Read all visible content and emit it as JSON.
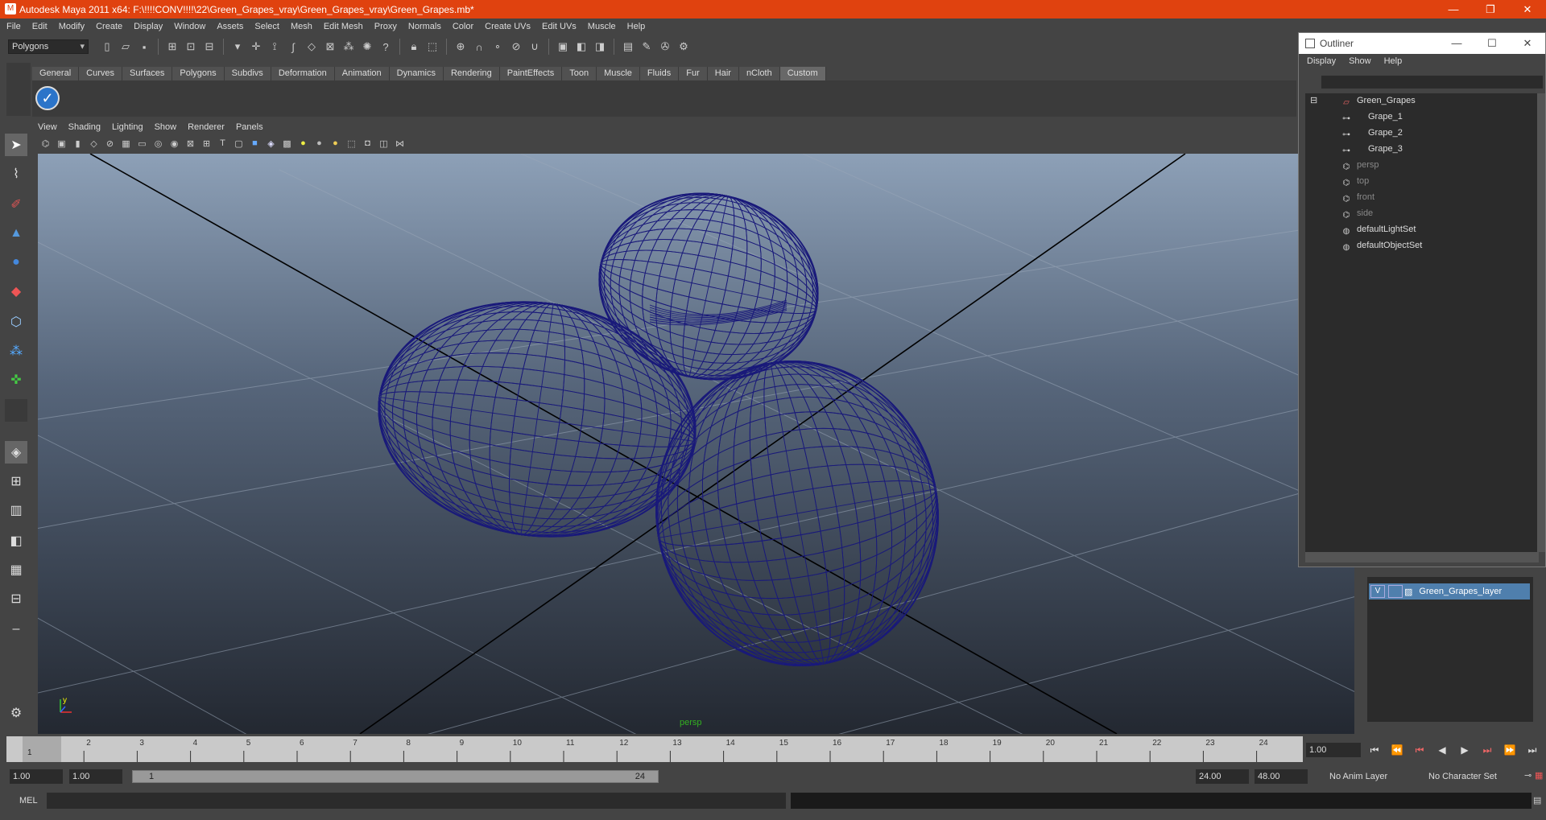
{
  "window": {
    "title": "Autodesk Maya 2011 x64: F:\\!!!!CONV!!!!\\22\\Green_Grapes_vray\\Green_Grapes_vray\\Green_Grapes.mb*"
  },
  "menubar": [
    "File",
    "Edit",
    "Modify",
    "Create",
    "Display",
    "Window",
    "Assets",
    "Select",
    "Mesh",
    "Edit Mesh",
    "Proxy",
    "Normals",
    "Color",
    "Create UVs",
    "Edit UVs",
    "Muscle",
    "Help"
  ],
  "statusline": {
    "mode": "Polygons"
  },
  "shelf": {
    "tabs": [
      "General",
      "Curves",
      "Surfaces",
      "Polygons",
      "Subdivs",
      "Deformation",
      "Animation",
      "Dynamics",
      "Rendering",
      "PaintEffects",
      "Toon",
      "Muscle",
      "Fluids",
      "Fur",
      "Hair",
      "nCloth",
      "Custom"
    ],
    "active": "Custom"
  },
  "viewport": {
    "menu": [
      "View",
      "Shading",
      "Lighting",
      "Show",
      "Renderer",
      "Panels"
    ],
    "camera": "persp",
    "wire_color": "#1a1a7a"
  },
  "outliner": {
    "title": "Outliner",
    "menu": [
      "Display",
      "Show",
      "Help"
    ],
    "items": [
      {
        "label": "Green_Grapes",
        "depth": 0,
        "dim": false
      },
      {
        "label": "Grape_1",
        "depth": 1,
        "dim": false
      },
      {
        "label": "Grape_2",
        "depth": 1,
        "dim": false
      },
      {
        "label": "Grape_3",
        "depth": 1,
        "dim": false
      },
      {
        "label": "persp",
        "depth": 0,
        "dim": true
      },
      {
        "label": "top",
        "depth": 0,
        "dim": true
      },
      {
        "label": "front",
        "depth": 0,
        "dim": true
      },
      {
        "label": "side",
        "depth": 0,
        "dim": true
      },
      {
        "label": "defaultLightSet",
        "depth": 0,
        "dim": false
      },
      {
        "label": "defaultObjectSet",
        "depth": 0,
        "dim": false
      }
    ]
  },
  "layers": {
    "visible_flag": "V",
    "name": "Green_Grapes_layer"
  },
  "timeslider": {
    "ticks": [
      "1",
      "2",
      "3",
      "4",
      "5",
      "6",
      "7",
      "8",
      "9",
      "10",
      "11",
      "12",
      "13",
      "14",
      "15",
      "16",
      "17",
      "18",
      "19",
      "20",
      "21",
      "22",
      "23",
      "24"
    ],
    "current": "1",
    "current_field": "1.00"
  },
  "range": {
    "start": "1.00",
    "start2": "1.00",
    "slider_start": "1",
    "slider_end": "24",
    "end": "24.00",
    "end2": "48.00",
    "anim_layer": "No Anim Layer",
    "char_set": "No Character Set"
  },
  "cmdline": {
    "label": "MEL"
  }
}
